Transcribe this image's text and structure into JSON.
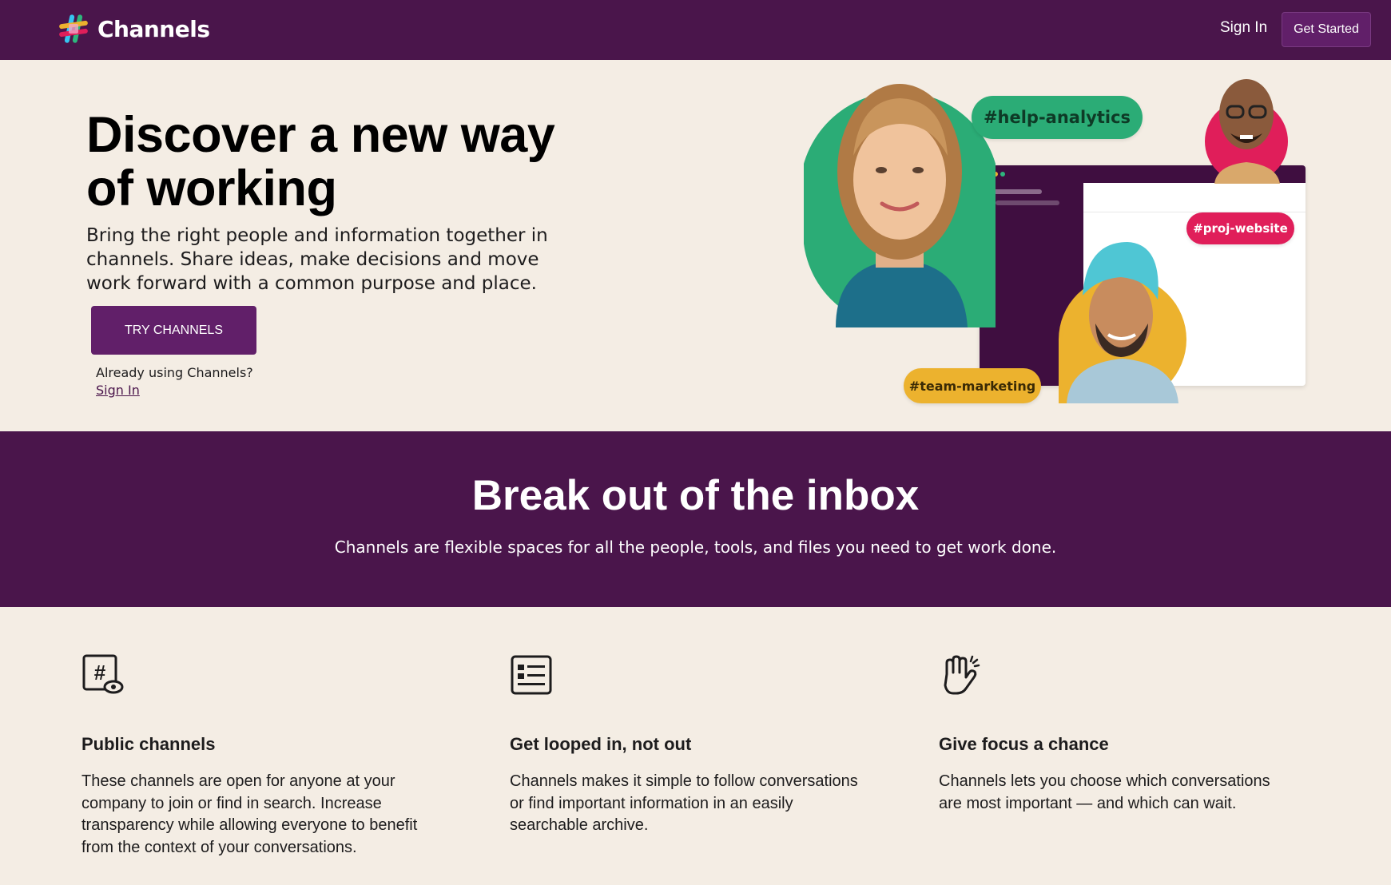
{
  "header": {
    "brand": "Channels",
    "sign_in": "Sign In",
    "get_started": "Get Started"
  },
  "hero": {
    "title": "Discover a new way of working",
    "subtitle": "Bring the right people and information together in channels. Share ideas, make decisions and move work forward with a common purpose and place.",
    "cta": "TRY CHANNELS",
    "already": "Already using Channels?",
    "sign_in": "Sign In",
    "tags": {
      "help": "#help-analytics",
      "proj": "#proj-website",
      "team": "#team-marketing"
    }
  },
  "band": {
    "title": "Break out of the inbox",
    "subtitle": "Channels are flexible spaces for all the people, tools, and files you need to get work done."
  },
  "features": [
    {
      "icon": "public-channel-icon",
      "title": "Public channels",
      "body": "These channels are open for anyone at your company to join or find in search. Increase transparency while allowing everyone to benefit from the context of your conversations."
    },
    {
      "icon": "searchable-archive-icon",
      "title": "Get looped in, not out",
      "body": "Channels makes it simple to follow conversations or find important information in an easily searchable archive."
    },
    {
      "icon": "high-five-icon",
      "title": "Give focus a chance",
      "body": "Channels lets you choose which conversations are most important — and which can wait."
    }
  ],
  "colors": {
    "brand_purple": "#4a154b",
    "button_purple": "#611f69",
    "page_bg": "#f4ede4",
    "tag_green": "#2bac76",
    "tag_pink": "#e01e5a",
    "tag_yellow": "#ecb22e"
  }
}
